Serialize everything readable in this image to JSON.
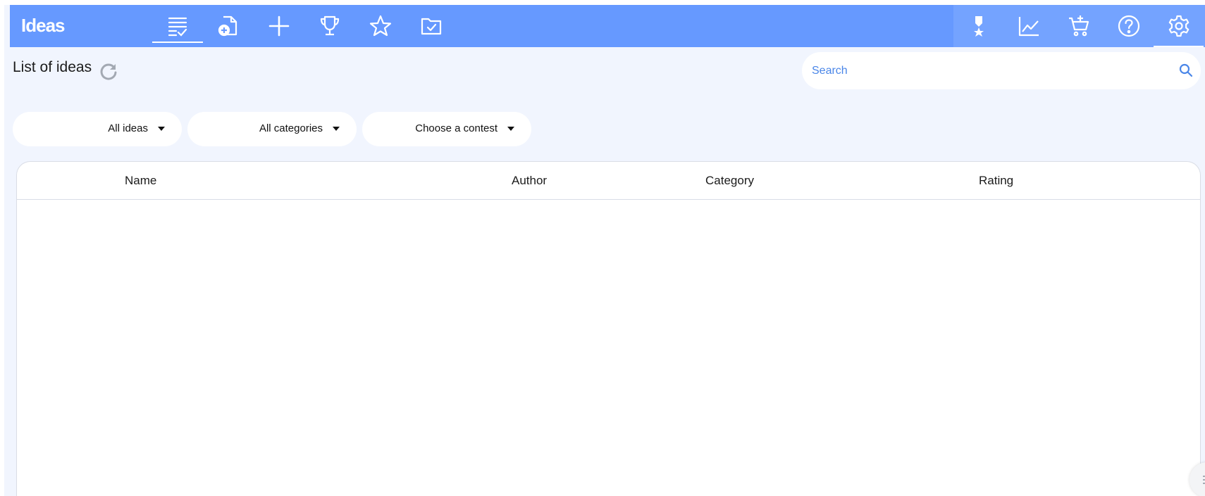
{
  "app": {
    "title": "Ideas"
  },
  "nav_left": [
    {
      "name": "idea-list-icon",
      "active": true
    },
    {
      "name": "add-document-icon",
      "active": false
    },
    {
      "name": "plus-icon",
      "active": false
    },
    {
      "name": "trophy-icon",
      "active": false
    },
    {
      "name": "star-icon",
      "active": false
    },
    {
      "name": "folder-check-icon",
      "active": false
    }
  ],
  "nav_right": [
    {
      "name": "medal-icon",
      "active": false
    },
    {
      "name": "chart-line-icon",
      "active": false
    },
    {
      "name": "cart-add-icon",
      "active": false
    },
    {
      "name": "help-icon",
      "active": false
    },
    {
      "name": "gear-icon",
      "active": true
    }
  ],
  "header": {
    "title": "List of ideas"
  },
  "search": {
    "placeholder": "Search"
  },
  "filters": {
    "ideas": "All ideas",
    "categories": "All categories",
    "contest": "Choose a contest"
  },
  "table": {
    "columns": {
      "name": "Name",
      "author": "Author",
      "category": "Category",
      "rating": "Rating"
    },
    "rows": []
  },
  "colors": {
    "topbar": "#6699ff",
    "topbar_right": "#74a3ff",
    "background": "#f1f5fe",
    "accent": "#4a86e8"
  }
}
